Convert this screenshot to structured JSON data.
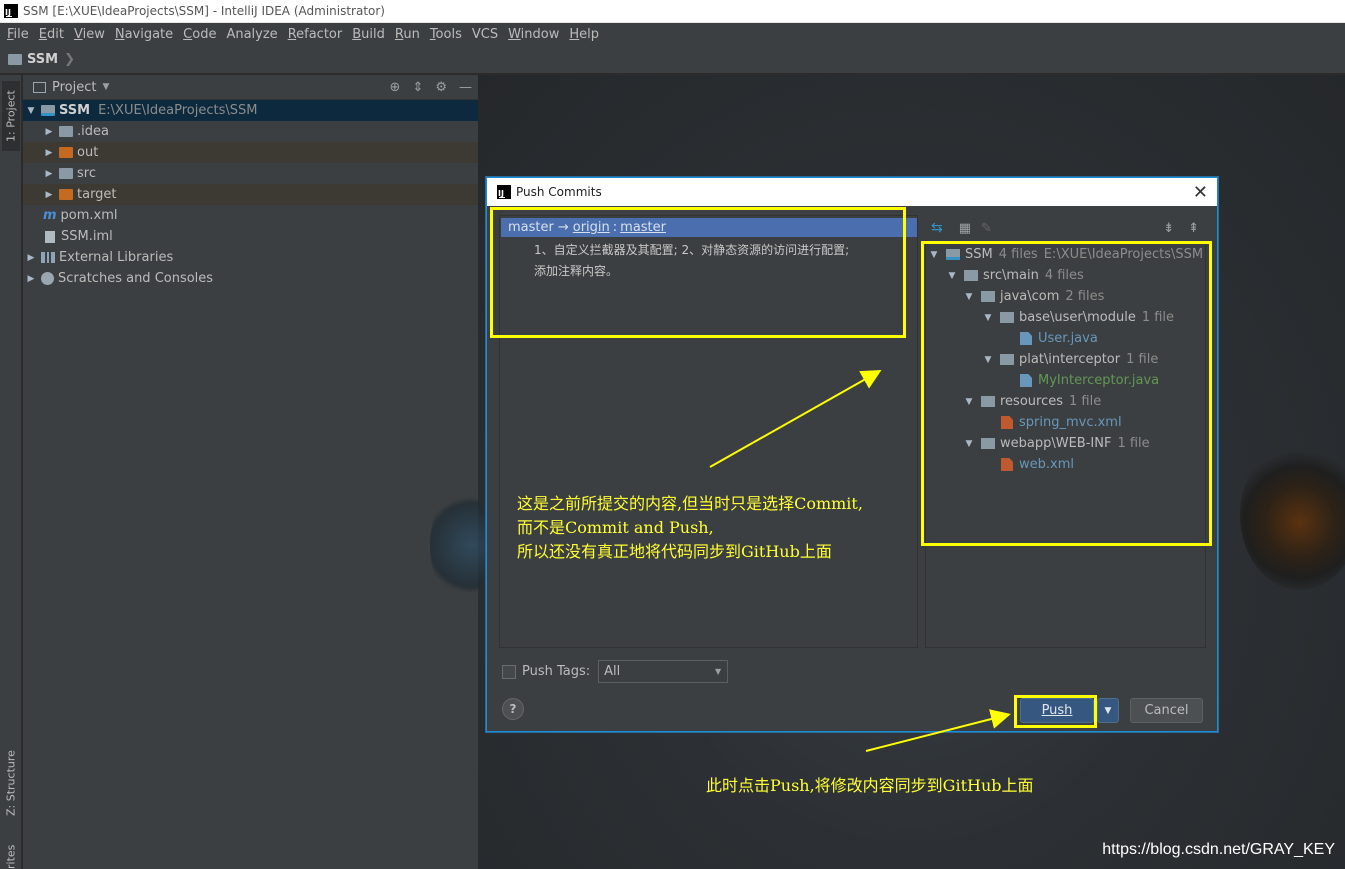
{
  "window": {
    "title": "SSM [E:\\XUE\\IdeaProjects\\SSM] - IntelliJ IDEA (Administrator)",
    "logo": "IJ"
  },
  "menu": [
    {
      "label": "File",
      "mnemonic": "F",
      "rest": "ile"
    },
    {
      "label": "Edit",
      "mnemonic": "E",
      "rest": "dit"
    },
    {
      "label": "View",
      "mnemonic": "V",
      "rest": "iew"
    },
    {
      "label": "Navigate",
      "mnemonic": "N",
      "rest": "avigate"
    },
    {
      "label": "Code",
      "mnemonic": "C",
      "rest": "ode"
    },
    {
      "label": "Analyze",
      "mnemonic": "",
      "rest": "Analyze"
    },
    {
      "label": "Refactor",
      "mnemonic": "R",
      "rest": "efactor"
    },
    {
      "label": "Build",
      "mnemonic": "B",
      "rest": "uild"
    },
    {
      "label": "Run",
      "mnemonic": "R",
      "rest": "un"
    },
    {
      "label": "Tools",
      "mnemonic": "T",
      "rest": "ools"
    },
    {
      "label": "VCS",
      "mnemonic": "",
      "rest": "VCS"
    },
    {
      "label": "Window",
      "mnemonic": "W",
      "rest": "indow"
    },
    {
      "label": "Help",
      "mnemonic": "H",
      "rest": "elp"
    }
  ],
  "navbar": {
    "project": "SSM"
  },
  "stripe": {
    "project_tab": "1: Project",
    "structure_tab": "Z: Structure",
    "favorites_tab": "rites"
  },
  "project_panel": {
    "title": "Project",
    "root": {
      "name": "SSM",
      "path": "E:\\XUE\\IdeaProjects\\SSM"
    },
    "items": [
      ".idea",
      "out",
      "src",
      "target",
      "pom.xml",
      "SSM.iml"
    ],
    "external_libraries": "External Libraries",
    "scratches": "Scratches and Consoles"
  },
  "dialog": {
    "title": "Push Commits",
    "branch": "master",
    "arrow": "→",
    "remote": "origin",
    "colon": ":",
    "target": "master",
    "message_line1": "1、自定义拦截器及其配置; 2、对静态资源的访问进行配置;",
    "message_line2": "添加注释内容。",
    "files": {
      "root": {
        "name": "SSM",
        "count": "4 files",
        "path": "E:\\XUE\\IdeaProjects\\SSM"
      },
      "src_main": {
        "name": "src\\main",
        "count": "4 files"
      },
      "java_com": {
        "name": "java\\com",
        "count": "2 files"
      },
      "base": {
        "name": "base\\user\\module",
        "count": "1 file"
      },
      "user_java": "User.java",
      "plat": {
        "name": "plat\\interceptor",
        "count": "1 file"
      },
      "my_interceptor": "MyInterceptor.java",
      "resources": {
        "name": "resources",
        "count": "1 file"
      },
      "spring_mvc": "spring_mvc.xml",
      "webapp": {
        "name": "webapp\\WEB-INF",
        "count": "1 file"
      },
      "web_xml": "web.xml"
    },
    "push_tags_label": "Push Tags:",
    "push_tags_mnemonic": "T",
    "tags_option": "All",
    "help": "?",
    "push_button": "Push",
    "cancel_button": "Cancel"
  },
  "annotations": {
    "note1_line1": "这是之前所提交的内容,但当时只是选择Commit,",
    "note1_line2": "而不是Commit and Push,",
    "note1_line3": "所以还没有真正地将代码同步到GitHub上面",
    "note2": "此时点击Push,将修改内容同步到GitHub上面",
    "highlight_color": "#ffff00"
  },
  "watermark": "https://blog.csdn.net/GRAY_KEY"
}
